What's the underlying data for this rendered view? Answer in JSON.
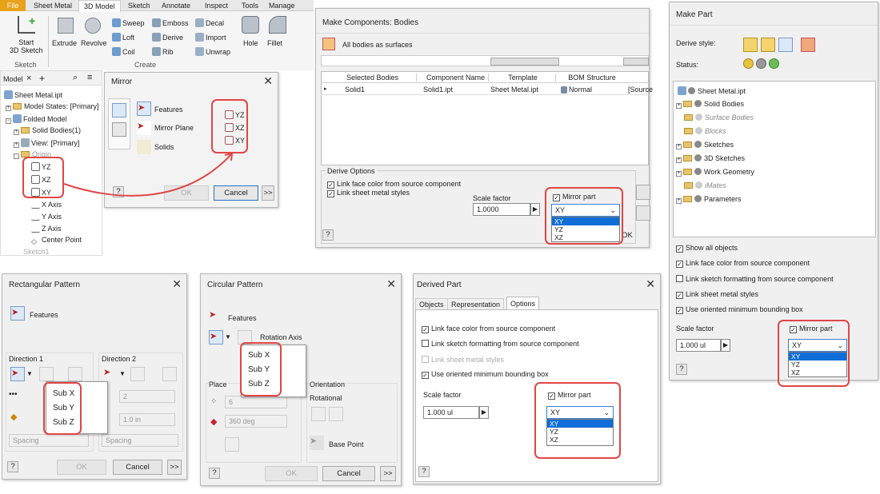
{
  "ribbon": {
    "tabs": [
      "File",
      "Sheet Metal",
      "3D Model",
      "Sketch",
      "Annotate",
      "Inspect",
      "Tools",
      "Manage"
    ],
    "start_sketch": "Start\n3D Sketch",
    "extrude": "Extrude",
    "revolve": "Revolve",
    "sweep": "Sweep",
    "emboss": "Emboss",
    "decal": "Decal",
    "loft": "Loft",
    "derive": "Derive",
    "import": "Import",
    "coil": "Coil",
    "rib": "Rib",
    "unwrap": "Unwrap",
    "hole": "Hole",
    "fillet": "Fillet",
    "group_sketch": "Sketch",
    "group_create": "Create"
  },
  "browser": {
    "tab_model": "Model",
    "tree": [
      "Sheet Metal.ipt",
      "Model States: [Primary]",
      "Folded Model",
      "Solid Bodies(1)",
      "View: [Primary]",
      "Origin",
      "YZ",
      "XZ",
      "XY",
      "X Axis",
      "Y Axis",
      "Z Axis",
      "Center Point",
      "Sketch1"
    ]
  },
  "mirror": {
    "title": "Mirror",
    "features": "Features",
    "mirror_plane": "Mirror Plane",
    "solids": "Solids",
    "planes": [
      "YZ",
      "XZ",
      "XY"
    ],
    "ok": "OK",
    "cancel": "Cancel",
    "more": ">>",
    "help": "?"
  },
  "make_components": {
    "title": "Make Components: Bodies",
    "all_bodies": "All bodies as surfaces",
    "headers": [
      "Selected Bodies",
      "Component Name",
      "Template",
      "BOM Structure"
    ],
    "row": [
      "Solid1",
      "Solid1.ipt",
      "Sheet Metal.ipt",
      "Normal",
      "[Source"
    ],
    "derive_options": "Derive Options",
    "link_face": "Link face color from source component",
    "link_sheet": "Link sheet metal styles",
    "scale_factor": "Scale factor",
    "scale_value": "1.0000",
    "mirror_part": "Mirror part",
    "selected": "XY",
    "options": [
      "XY",
      "YZ",
      "XZ"
    ],
    "ok": "OK",
    "help": "?"
  },
  "make_part": {
    "title": "Make Part",
    "derive_style": "Derive style:",
    "status": "Status:",
    "tree": [
      "Sheet Metal.ipt",
      "Solid Bodies",
      "Surface Bodies",
      "Blocks",
      "Sketches",
      "3D Sketches",
      "Work Geometry",
      "iMates",
      "Parameters"
    ],
    "checks": [
      "Show all objects",
      "Link face color from source component",
      "Link sketch formatting from source component",
      "Link sheet metal styles",
      "Use oriented minimum bounding box"
    ],
    "scale_factor": "Scale factor",
    "scale_value": "1.000 ul",
    "mirror_part": "Mirror part",
    "selected": "XY",
    "options": [
      "XY",
      "YZ",
      "XZ"
    ],
    "help": "?"
  },
  "rect_pattern": {
    "title": "Rectangular Pattern",
    "features": "Features",
    "dir1": "Direction 1",
    "dir2": "Direction 2",
    "count": "2",
    "distance": "1.0 in",
    "spacing": "Spacing",
    "menu": [
      "Sub X",
      "Sub Y",
      "Sub Z"
    ],
    "ok": "OK",
    "cancel": "Cancel",
    "more": ">>",
    "help": "?"
  },
  "circ_pattern": {
    "title": "Circular Pattern",
    "features": "Features",
    "rotation_axis": "Rotation Axis",
    "placement": "Place",
    "count": "6",
    "angle": "360 deg",
    "orientation": "Orientation",
    "rotational": "Rotational",
    "base_point": "Base Point",
    "menu": [
      "Sub X",
      "Sub Y",
      "Sub Z"
    ],
    "ok": "OK",
    "cancel": "Cancel",
    "more": ">>",
    "help": "?"
  },
  "derived_part": {
    "title": "Derived Part",
    "tabs": [
      "Objects",
      "Representation",
      "Options"
    ],
    "checks": [
      "Link face color from source component",
      "Link sketch formatting from source component",
      "Link sheet metal styles",
      "Use oriented minimum bounding box"
    ],
    "scale_factor": "Scale factor",
    "scale_value": "1.000 ul",
    "mirror_part": "Mirror part",
    "selected": "XY",
    "options": [
      "XY",
      "YZ",
      "XZ"
    ],
    "help": "?"
  },
  "colors": {
    "highlight": "#e04646",
    "accent": "#0f6ed8"
  }
}
